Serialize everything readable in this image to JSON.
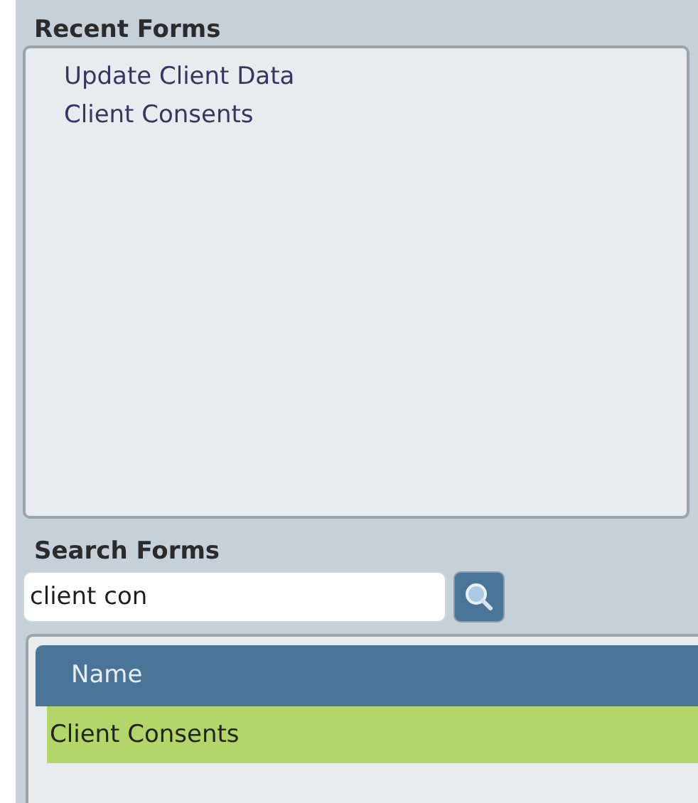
{
  "recent_forms": {
    "title": "Recent Forms",
    "items": [
      {
        "label": "Update Client Data"
      },
      {
        "label": "Client Consents"
      }
    ]
  },
  "search_forms": {
    "title": "Search Forms",
    "value": "client con"
  },
  "results": {
    "columns": [
      "Name"
    ],
    "rows": [
      {
        "name": "Client Consents",
        "selected": true
      }
    ]
  }
}
